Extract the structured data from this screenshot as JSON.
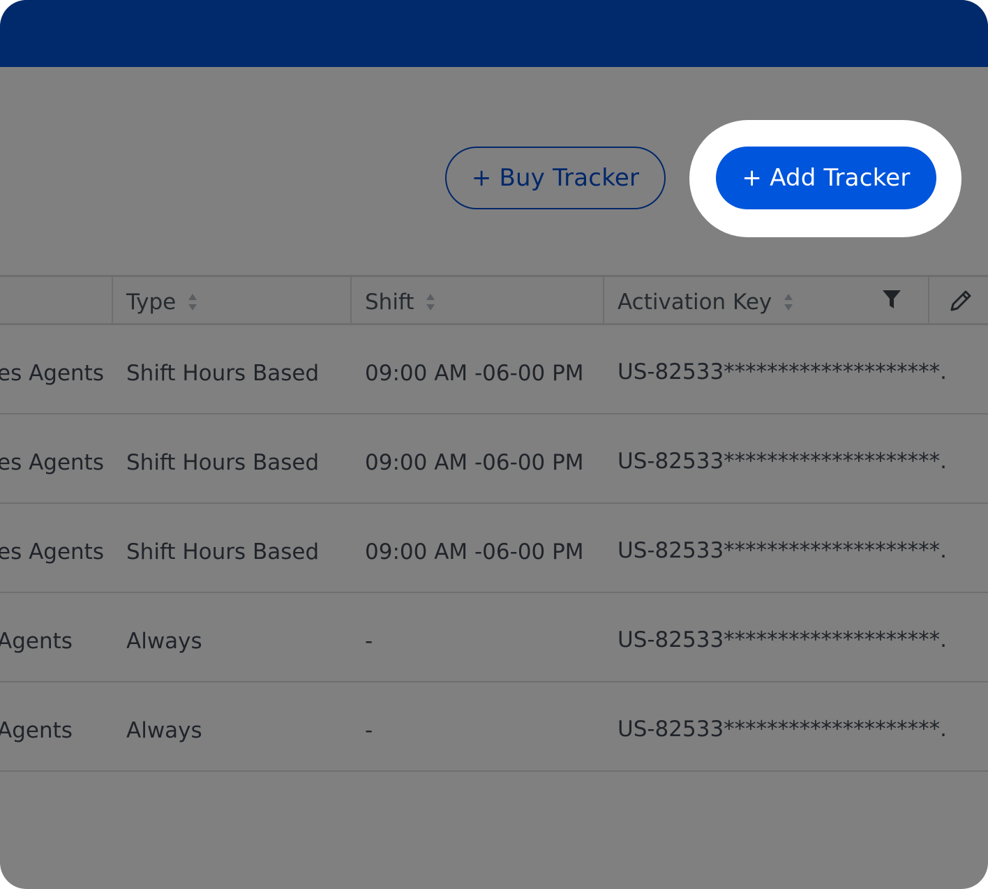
{
  "toolbar": {
    "buy_label": "+ Buy Tracker",
    "add_label": "+ Add Tracker"
  },
  "table": {
    "columns": [
      {
        "label": "Type"
      },
      {
        "label": "Shift"
      },
      {
        "label": "Activation Key"
      }
    ],
    "rows": [
      {
        "group": "es Agents",
        "type": "Shift Hours Based",
        "shift": "09:00 AM -06-00 PM",
        "key": "US-82533********************."
      },
      {
        "group": "es Agents",
        "type": "Shift Hours Based",
        "shift": "09:00 AM -06-00 PM",
        "key": "US-82533********************."
      },
      {
        "group": "es Agents",
        "type": "Shift Hours Based",
        "shift": "09:00 AM -06-00 PM",
        "key": "US-82533********************."
      },
      {
        "group": "Agents",
        "type": "Always",
        "shift": "-",
        "key": "US-82533********************."
      },
      {
        "group": "Agents",
        "type": "Always",
        "shift": "-",
        "key": "US-82533********************."
      }
    ]
  },
  "icons": {
    "filter": "filter-icon",
    "edit": "pencil-icon",
    "sort": "sort-icon"
  },
  "colors": {
    "topbar": "#002a6c",
    "overlay": "#808080",
    "primary_button": "#0055dd",
    "outline_button": "#00276a"
  }
}
